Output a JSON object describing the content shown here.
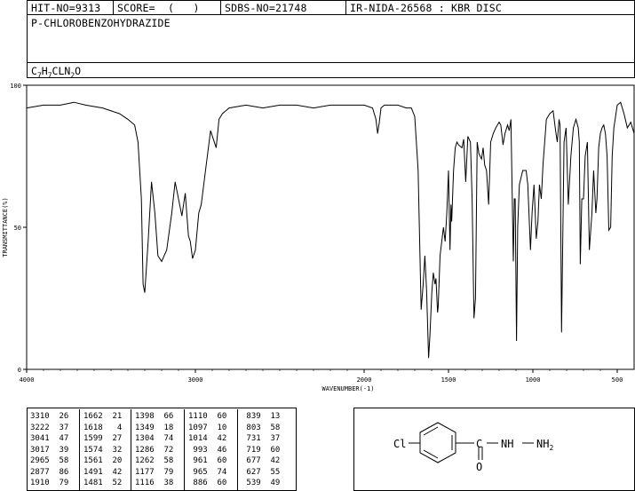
{
  "header": {
    "hit_no": "HIT-NO=9313",
    "score": "SCORE=  (   )",
    "sdbs_no": "SDBS-NO=21748",
    "ir_info": "IR-NIDA-26568 : KBR DISC"
  },
  "compound": {
    "name": "P-CHLOROBENZOHYDRAZIDE",
    "formula_parts": [
      "C",
      "7",
      "H",
      "7",
      "CLN",
      "2",
      "O"
    ]
  },
  "chart_data": {
    "type": "line",
    "title": "",
    "xlabel": "WAVENUMBER(-1)",
    "ylabel": "TRANSMITTANCE(%)",
    "xlim": [
      4000,
      400
    ],
    "ylim": [
      0,
      100
    ],
    "x_ticks": [
      4000,
      3000,
      2000,
      1500,
      1000,
      500
    ],
    "y_ticks": [
      0,
      50,
      100
    ],
    "grid": false,
    "x": [
      4000,
      3900,
      3800,
      3720,
      3650,
      3550,
      3450,
      3400,
      3360,
      3340,
      3320,
      3310,
      3300,
      3280,
      3260,
      3240,
      3222,
      3200,
      3170,
      3140,
      3120,
      3100,
      3080,
      3060,
      3041,
      3030,
      3017,
      3000,
      2980,
      2965,
      2940,
      2910,
      2877,
      2860,
      2840,
      2800,
      2700,
      2600,
      2500,
      2400,
      2300,
      2200,
      2100,
      2000,
      1950,
      1930,
      1920,
      1910,
      1900,
      1880,
      1850,
      1800,
      1750,
      1720,
      1700,
      1680,
      1662,
      1650,
      1640,
      1630,
      1618,
      1610,
      1599,
      1590,
      1580,
      1574,
      1565,
      1561,
      1550,
      1540,
      1530,
      1520,
      1510,
      1500,
      1491,
      1485,
      1481,
      1470,
      1460,
      1450,
      1440,
      1420,
      1410,
      1398,
      1385,
      1370,
      1360,
      1349,
      1340,
      1330,
      1320,
      1304,
      1295,
      1286,
      1275,
      1262,
      1250,
      1235,
      1220,
      1200,
      1190,
      1177,
      1165,
      1150,
      1140,
      1130,
      1116,
      1110,
      1105,
      1097,
      1090,
      1080,
      1060,
      1040,
      1030,
      1014,
      1005,
      993,
      980,
      970,
      961,
      950,
      940,
      920,
      900,
      880,
      865,
      855,
      845,
      839,
      830,
      815,
      803,
      790,
      775,
      760,
      745,
      731,
      725,
      719,
      710,
      700,
      690,
      677,
      665,
      650,
      640,
      627,
      620,
      610,
      600,
      590,
      580,
      570,
      560,
      550,
      539,
      530,
      520,
      500,
      480,
      460,
      440,
      420,
      400
    ],
    "y": [
      92,
      93,
      93,
      94,
      93,
      92,
      90,
      88,
      86,
      80,
      60,
      30,
      27,
      45,
      66,
      55,
      40,
      38,
      42,
      55,
      66,
      60,
      54,
      62,
      47,
      45,
      39,
      42,
      55,
      58,
      70,
      84,
      78,
      88,
      90,
      92,
      93,
      92,
      93,
      93,
      92,
      93,
      93,
      93,
      92,
      88,
      83,
      87,
      92,
      93,
      93,
      93,
      92,
      92,
      89,
      70,
      21,
      30,
      40,
      28,
      4,
      12,
      27,
      34,
      30,
      32,
      20,
      22,
      40,
      45,
      50,
      45,
      55,
      70,
      42,
      58,
      52,
      70,
      78,
      80,
      79,
      78,
      81,
      66,
      82,
      80,
      60,
      18,
      25,
      80,
      76,
      74,
      78,
      72,
      70,
      58,
      80,
      83,
      85,
      87,
      86,
      79,
      83,
      86,
      84,
      88,
      38,
      60,
      60,
      10,
      50,
      65,
      70,
      70,
      65,
      42,
      55,
      65,
      46,
      52,
      65,
      60,
      72,
      88,
      90,
      91,
      84,
      80,
      88,
      86,
      13,
      80,
      85,
      58,
      75,
      85,
      88,
      85,
      80,
      37,
      60,
      60,
      75,
      80,
      42,
      55,
      70,
      55,
      60,
      78,
      83,
      85,
      86,
      83,
      75,
      49,
      50,
      75,
      85,
      93,
      94,
      90,
      85,
      87,
      83
    ]
  },
  "peak_table": [
    [
      [
        "3310",
        "26"
      ],
      [
        "3222",
        "37"
      ],
      [
        "3041",
        "47"
      ],
      [
        "3017",
        "39"
      ],
      [
        "2965",
        "58"
      ],
      [
        "2877",
        "86"
      ],
      [
        "1910",
        "79"
      ]
    ],
    [
      [
        "1662",
        "21"
      ],
      [
        "1618",
        " 4"
      ],
      [
        "1599",
        "27"
      ],
      [
        "1574",
        "32"
      ],
      [
        "1561",
        "20"
      ],
      [
        "1491",
        "42"
      ],
      [
        "1481",
        "52"
      ]
    ],
    [
      [
        "1398",
        "66"
      ],
      [
        "1349",
        "18"
      ],
      [
        "1304",
        "74"
      ],
      [
        "1286",
        "72"
      ],
      [
        "1262",
        "58"
      ],
      [
        "1177",
        "79"
      ],
      [
        "1116",
        "38"
      ]
    ],
    [
      [
        "1110",
        "60"
      ],
      [
        "1097",
        "10"
      ],
      [
        "1014",
        "42"
      ],
      [
        " 993",
        "46"
      ],
      [
        " 961",
        "60"
      ],
      [
        " 965",
        "74"
      ],
      [
        " 886",
        "60"
      ]
    ],
    [
      [
        " 839",
        "13"
      ],
      [
        " 803",
        "58"
      ],
      [
        " 731",
        "37"
      ],
      [
        " 719",
        "60"
      ],
      [
        " 677",
        "42"
      ],
      [
        " 627",
        "55"
      ],
      [
        " 539",
        "49"
      ]
    ]
  ],
  "structure": {
    "cl_label": "Cl",
    "nh_label": "NH",
    "nh2_main": "NH",
    "nh2_sub": "2",
    "c_label": "C",
    "o_label": "O"
  }
}
